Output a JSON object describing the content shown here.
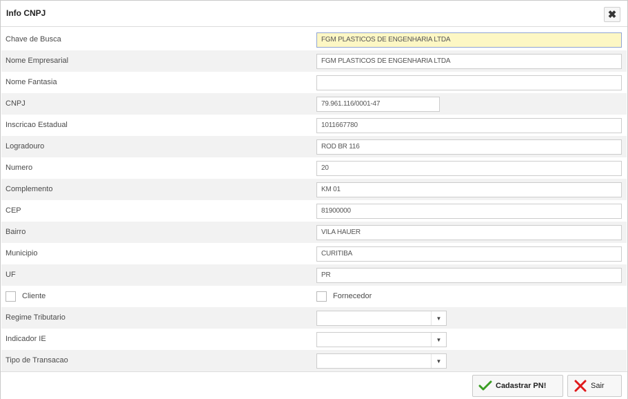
{
  "dialog": {
    "title": "Info CNPJ",
    "close_icon": "close-icon",
    "close_symbol": "✖"
  },
  "fields": [
    {
      "label": "Chave de Busca",
      "value": "FGM PLASTICOS DE ENGENHARIA LTDA"
    },
    {
      "label": "Nome Empresarial",
      "value": "FGM PLASTICOS DE ENGENHARIA LTDA"
    },
    {
      "label": "Nome Fantasia",
      "value": ""
    },
    {
      "label": "CNPJ",
      "value": "79.961.116/0001-47"
    },
    {
      "label": "Inscricao Estadual",
      "value": "1011667780"
    },
    {
      "label": "Logradouro",
      "value": "ROD BR 116"
    },
    {
      "label": "Numero",
      "value": "20"
    },
    {
      "label": "Complemento",
      "value": "KM 01"
    },
    {
      "label": "CEP",
      "value": "81900000"
    },
    {
      "label": "Bairro",
      "value": "VILA HAUER"
    },
    {
      "label": "Municipio",
      "value": "CURITIBA"
    },
    {
      "label": "UF",
      "value": "PR"
    }
  ],
  "checkboxes": {
    "cliente": "Cliente",
    "fornecedor": "Fornecedor"
  },
  "selects": [
    {
      "label": "Regime Tributario",
      "value": ""
    },
    {
      "label": "Indicador IE",
      "value": ""
    },
    {
      "label": "Tipo de Transacao",
      "value": ""
    }
  ],
  "caret_symbol": "▼",
  "footer": {
    "cadastrar_label": "Cadastrar PN!",
    "sair_label": "Sair"
  },
  "colors": {
    "search_bg": "#fdf7c4",
    "check_green": "#3a9d23",
    "exit_red": "#e0191b"
  }
}
